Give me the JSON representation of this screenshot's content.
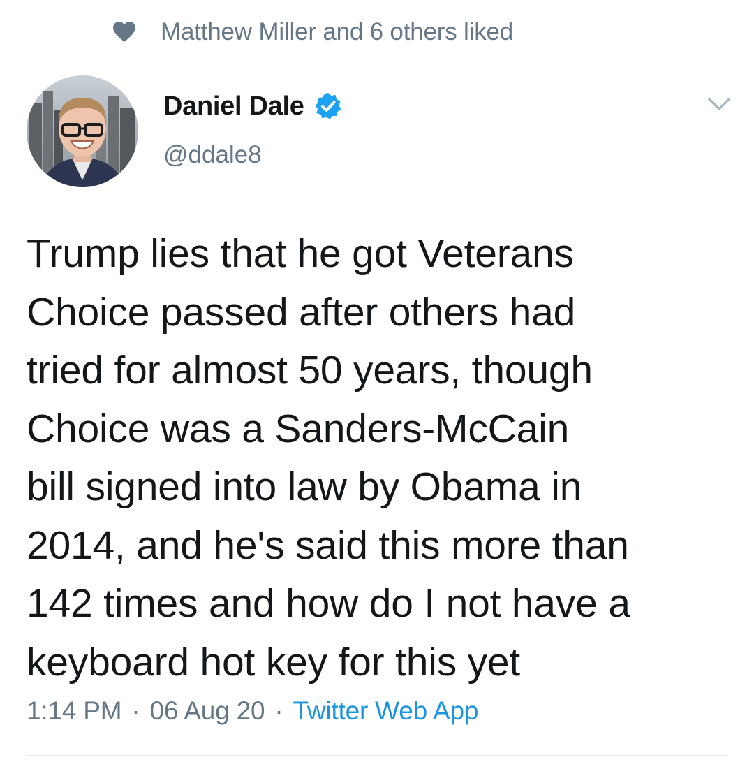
{
  "social_context": {
    "icon": "heart-icon",
    "text": "Matthew Miller and 6 others liked"
  },
  "author": {
    "name": "Daniel Dale",
    "handle": "@ddale8",
    "verified": true,
    "verified_icon": "verified-badge-icon",
    "avatar_icon": "avatar"
  },
  "menu": {
    "icon": "chevron-down-icon"
  },
  "tweet": {
    "text": "Trump lies that he got Veterans\nChoice passed after others had\ntried for almost 50 years, though\nChoice was a Sanders-McCain\nbill signed into law by Obama in\n2014, and he's said this more than\n142 times and how do I not have a\nkeyboard hot key for this yet"
  },
  "meta": {
    "time": "1:14 PM",
    "separator": "·",
    "date": "06 Aug 20",
    "source": "Twitter Web App"
  },
  "colors": {
    "text_primary": "#14171a",
    "text_secondary": "#657786",
    "link": "#1b95e0",
    "verified": "#1da1f2",
    "divider": "#e6ecf0"
  }
}
